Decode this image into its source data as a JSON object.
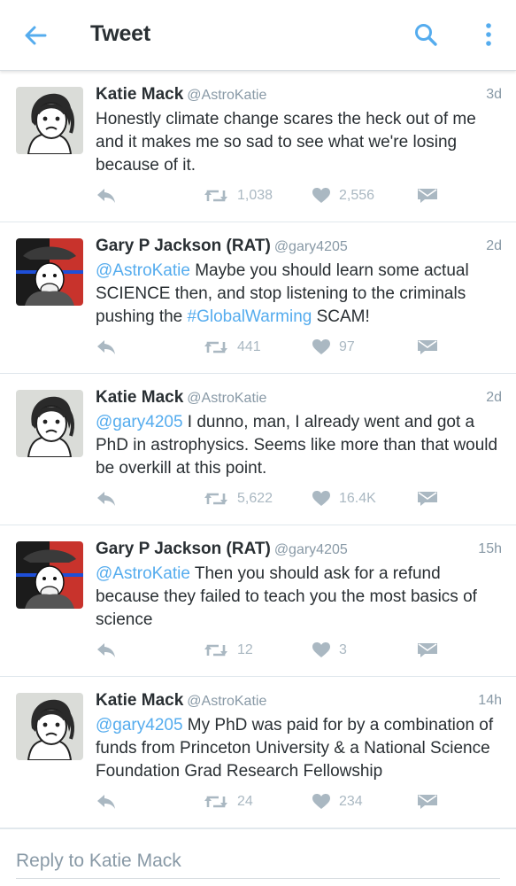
{
  "app_bar": {
    "title": "Tweet",
    "icons": [
      "arrow-left-icon",
      "search-icon",
      "more-vertical-icon"
    ]
  },
  "colors": {
    "accent": "#55acee",
    "text": "#292f33",
    "muted": "#8899a6",
    "action": "#aab8c2",
    "divider": "#e1e8ed"
  },
  "tweets": [
    {
      "name": "Katie Mack",
      "handle": "@AstroKatie",
      "time": "3d",
      "mention": "",
      "text": "Honestly climate change scares the heck out of me and it makes me so sad to see what we're losing because of it.",
      "hashtag": "",
      "text_after": "",
      "retweets": "1,038",
      "likes": "2,556"
    },
    {
      "name": "Gary P Jackson (RAT)",
      "handle": "@gary4205",
      "time": "2d",
      "mention": "@AstroKatie",
      "text": " Maybe you should learn some actual SCIENCE then, and stop listening to the criminals pushing the ",
      "hashtag": "#GlobalWarming",
      "text_after": " SCAM!",
      "retweets": "441",
      "likes": "97"
    },
    {
      "name": "Katie Mack",
      "handle": "@AstroKatie",
      "time": "2d",
      "mention": "@gary4205",
      "text": " I dunno, man, I already went and got a PhD in astrophysics. Seems like more than that would be overkill at this point.",
      "hashtag": "",
      "text_after": "",
      "retweets": "5,622",
      "likes": "16.4K"
    },
    {
      "name": "Gary P Jackson (RAT)",
      "handle": "@gary4205",
      "time": "15h",
      "mention": "@AstroKatie",
      "text": " Then you should ask for a refund because they failed to teach you the most basics of science",
      "hashtag": "",
      "text_after": "",
      "retweets": "12",
      "likes": "3"
    },
    {
      "name": "Katie Mack",
      "handle": "@AstroKatie",
      "time": "14h",
      "mention": "@gary4205",
      "text": " My PhD was paid for by a combination of funds from Princeton University & a National Science Foundation Grad Research Fellowship",
      "hashtag": "",
      "text_after": "",
      "retweets": "24",
      "likes": "234"
    }
  ],
  "reply": {
    "placeholder": "Reply to Katie Mack"
  }
}
